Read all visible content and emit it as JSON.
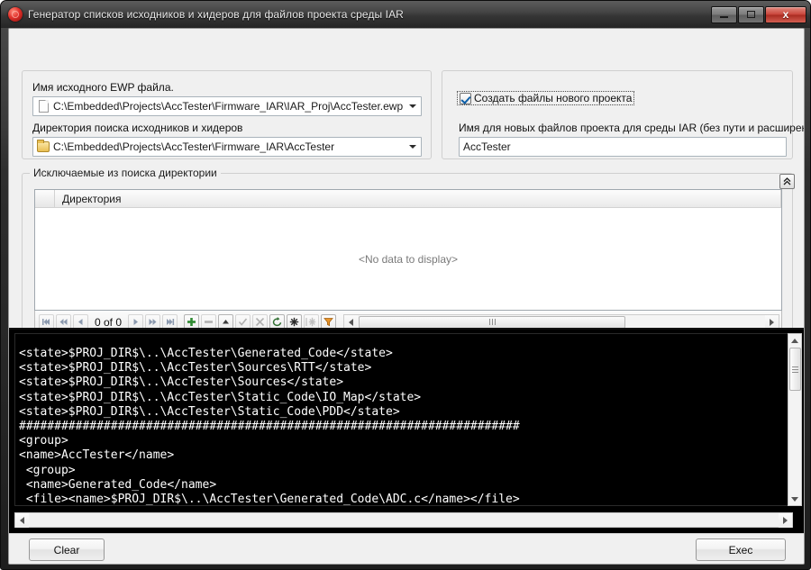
{
  "window": {
    "title": "Генератор списков исходников и хидеров для файлов проекта среды IAR",
    "app_icon": "red-ball-icon",
    "caption": {
      "minimize": "minimize-icon",
      "maximize": "maximize-icon",
      "close_label": "x"
    }
  },
  "source_group": {
    "ewp_label": "Имя исходного EWP файла.",
    "ewp_value": "C:\\Embedded\\Projects\\AccTester\\Firmware_IAR\\IAR_Proj\\AccTester.ewp",
    "dir_label": "Директория поиска исходников и хидеров",
    "dir_value": "C:\\Embedded\\Projects\\AccTester\\Firmware_IAR\\AccTester"
  },
  "new_project_group": {
    "checkbox_label": "Создать файлы нового проекта",
    "checkbox_checked": true,
    "name_label": "Имя для новых файлов проекта для среды IAR (без пути и расширения)",
    "name_value": "AccTester"
  },
  "excluded_group": {
    "title": "Исключаемые из поиска директории",
    "collapse_icon": "chevron-double-up-icon",
    "grid": {
      "columns": [
        "Директория"
      ],
      "rows": [],
      "empty_text": "<No data to display>"
    },
    "navigator": {
      "position_text": "0 of 0",
      "buttons": [
        "first-record-button",
        "prior-page-button",
        "prior-record-button",
        "next-record-button",
        "next-page-button",
        "last-record-button",
        "insert-record-button",
        "delete-record-button",
        "edit-record-button",
        "post-edit-button",
        "cancel-edit-button",
        "refresh-button",
        "clear-filter-button",
        "apply-filter-button",
        "filter-builder-button"
      ]
    }
  },
  "console": {
    "lines": [
      "<state>$PROJ_DIR$\\..\\AccTester\\Generated_Code</state>",
      "<state>$PROJ_DIR$\\..\\AccTester\\Sources\\RTT</state>",
      "<state>$PROJ_DIR$\\..\\AccTester\\Sources</state>",
      "<state>$PROJ_DIR$\\..\\AccTester\\Static_Code\\IO_Map</state>",
      "<state>$PROJ_DIR$\\..\\AccTester\\Static_Code\\PDD</state>",
      "#######################################################################",
      "<group>",
      "<name>AccTester</name>",
      " <group>",
      " <name>Generated_Code</name>",
      " <file><name>$PROJ_DIR$\\..\\AccTester\\Generated_Code\\ADC.c</name></file>"
    ],
    "text_color": "#ffffff",
    "background_color": "#000000"
  },
  "bottom_bar": {
    "clear_label": "Clear",
    "exec_label": "Exec"
  }
}
